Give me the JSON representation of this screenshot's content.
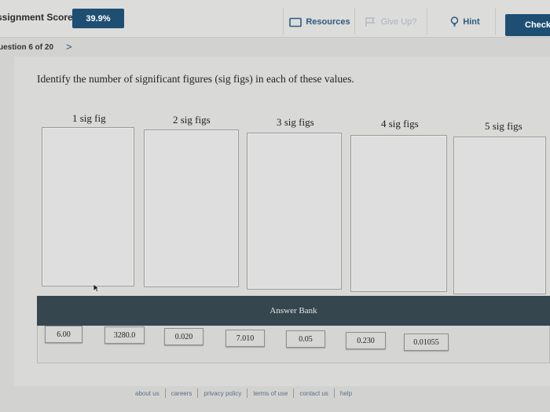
{
  "header": {
    "score_label": "ssignment Score:",
    "score_value": "39.9%",
    "resources_label": "Resources",
    "giveup_label": "Give Up?",
    "hint_label": "Hint",
    "check_label": "Check"
  },
  "nav": {
    "question_label": "uestion 6 of 20",
    "next_glyph": ">"
  },
  "question": {
    "prompt": "Identify the number of significant figures (sig figs) in each of these values."
  },
  "categories": [
    "1 sig fig",
    "2 sig figs",
    "3 sig figs",
    "4 sig figs",
    "5 sig figs"
  ],
  "answer_bank": {
    "title": "Answer Bank",
    "items": [
      "6.00",
      "3280.0",
      "0.020",
      "7.010",
      "0.05",
      "0.230",
      "0.01055"
    ]
  },
  "footer": {
    "links": [
      "about us",
      "careers",
      "privacy policy",
      "terms of use",
      "contact us",
      "help"
    ]
  },
  "colors": {
    "primary": "#1e4f73",
    "bank_header": "#36464f",
    "link": "#2e5a80"
  },
  "icons": {
    "resources": "folder-icon",
    "giveup": "flag-icon",
    "hint": "lightbulb-icon",
    "next": "chevron-right-icon",
    "cursor": "mouse-pointer-icon"
  }
}
